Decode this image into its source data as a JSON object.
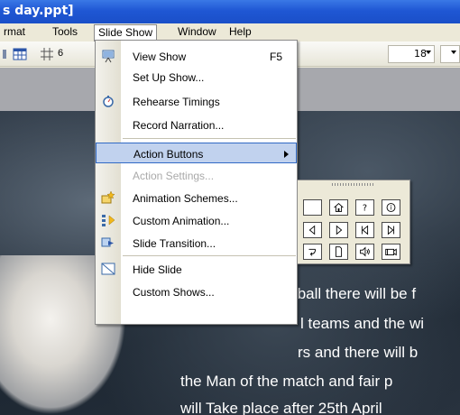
{
  "window": {
    "title": "s day.ppt]"
  },
  "menubar": {
    "items": [
      {
        "label": "rmat"
      },
      {
        "label": "Tools"
      },
      {
        "label": "Slide Show"
      },
      {
        "label": "Window"
      },
      {
        "label": "Help"
      }
    ]
  },
  "toolbar": {
    "zoom_partial": "6",
    "font_size": "18"
  },
  "dropdown": {
    "items": [
      {
        "label": "View Show",
        "shortcut": "F5"
      },
      {
        "label": "Set Up Show..."
      },
      {
        "label": "Rehearse Timings"
      },
      {
        "label": "Record Narration..."
      },
      {
        "label": "Action Buttons"
      },
      {
        "label": "Action Settings..."
      },
      {
        "label": "Animation Schemes..."
      },
      {
        "label": "Custom Animation..."
      },
      {
        "label": "Slide Transition..."
      },
      {
        "label": "Hide Slide"
      },
      {
        "label": "Custom Shows..."
      }
    ]
  },
  "action_buttons": {
    "buttons": [
      "custom-button",
      "home-button",
      "help-button",
      "information-button",
      "back-button",
      "forward-button",
      "beginning-button",
      "end-button",
      "return-button",
      "document-button",
      "sound-button",
      "movie-button"
    ]
  },
  "slide": {
    "lines": [
      "tball there will be f",
      "l teams and the wi",
      "rs and there will b",
      "the Man of the match and fair p",
      "will Take place after 25th April"
    ]
  },
  "colors": {
    "title_bar": "#1f57d4",
    "menu_highlight": "#c1d2ee",
    "menu_highlight_border": "#316ac5",
    "disabled_text": "#a9a9a9"
  }
}
